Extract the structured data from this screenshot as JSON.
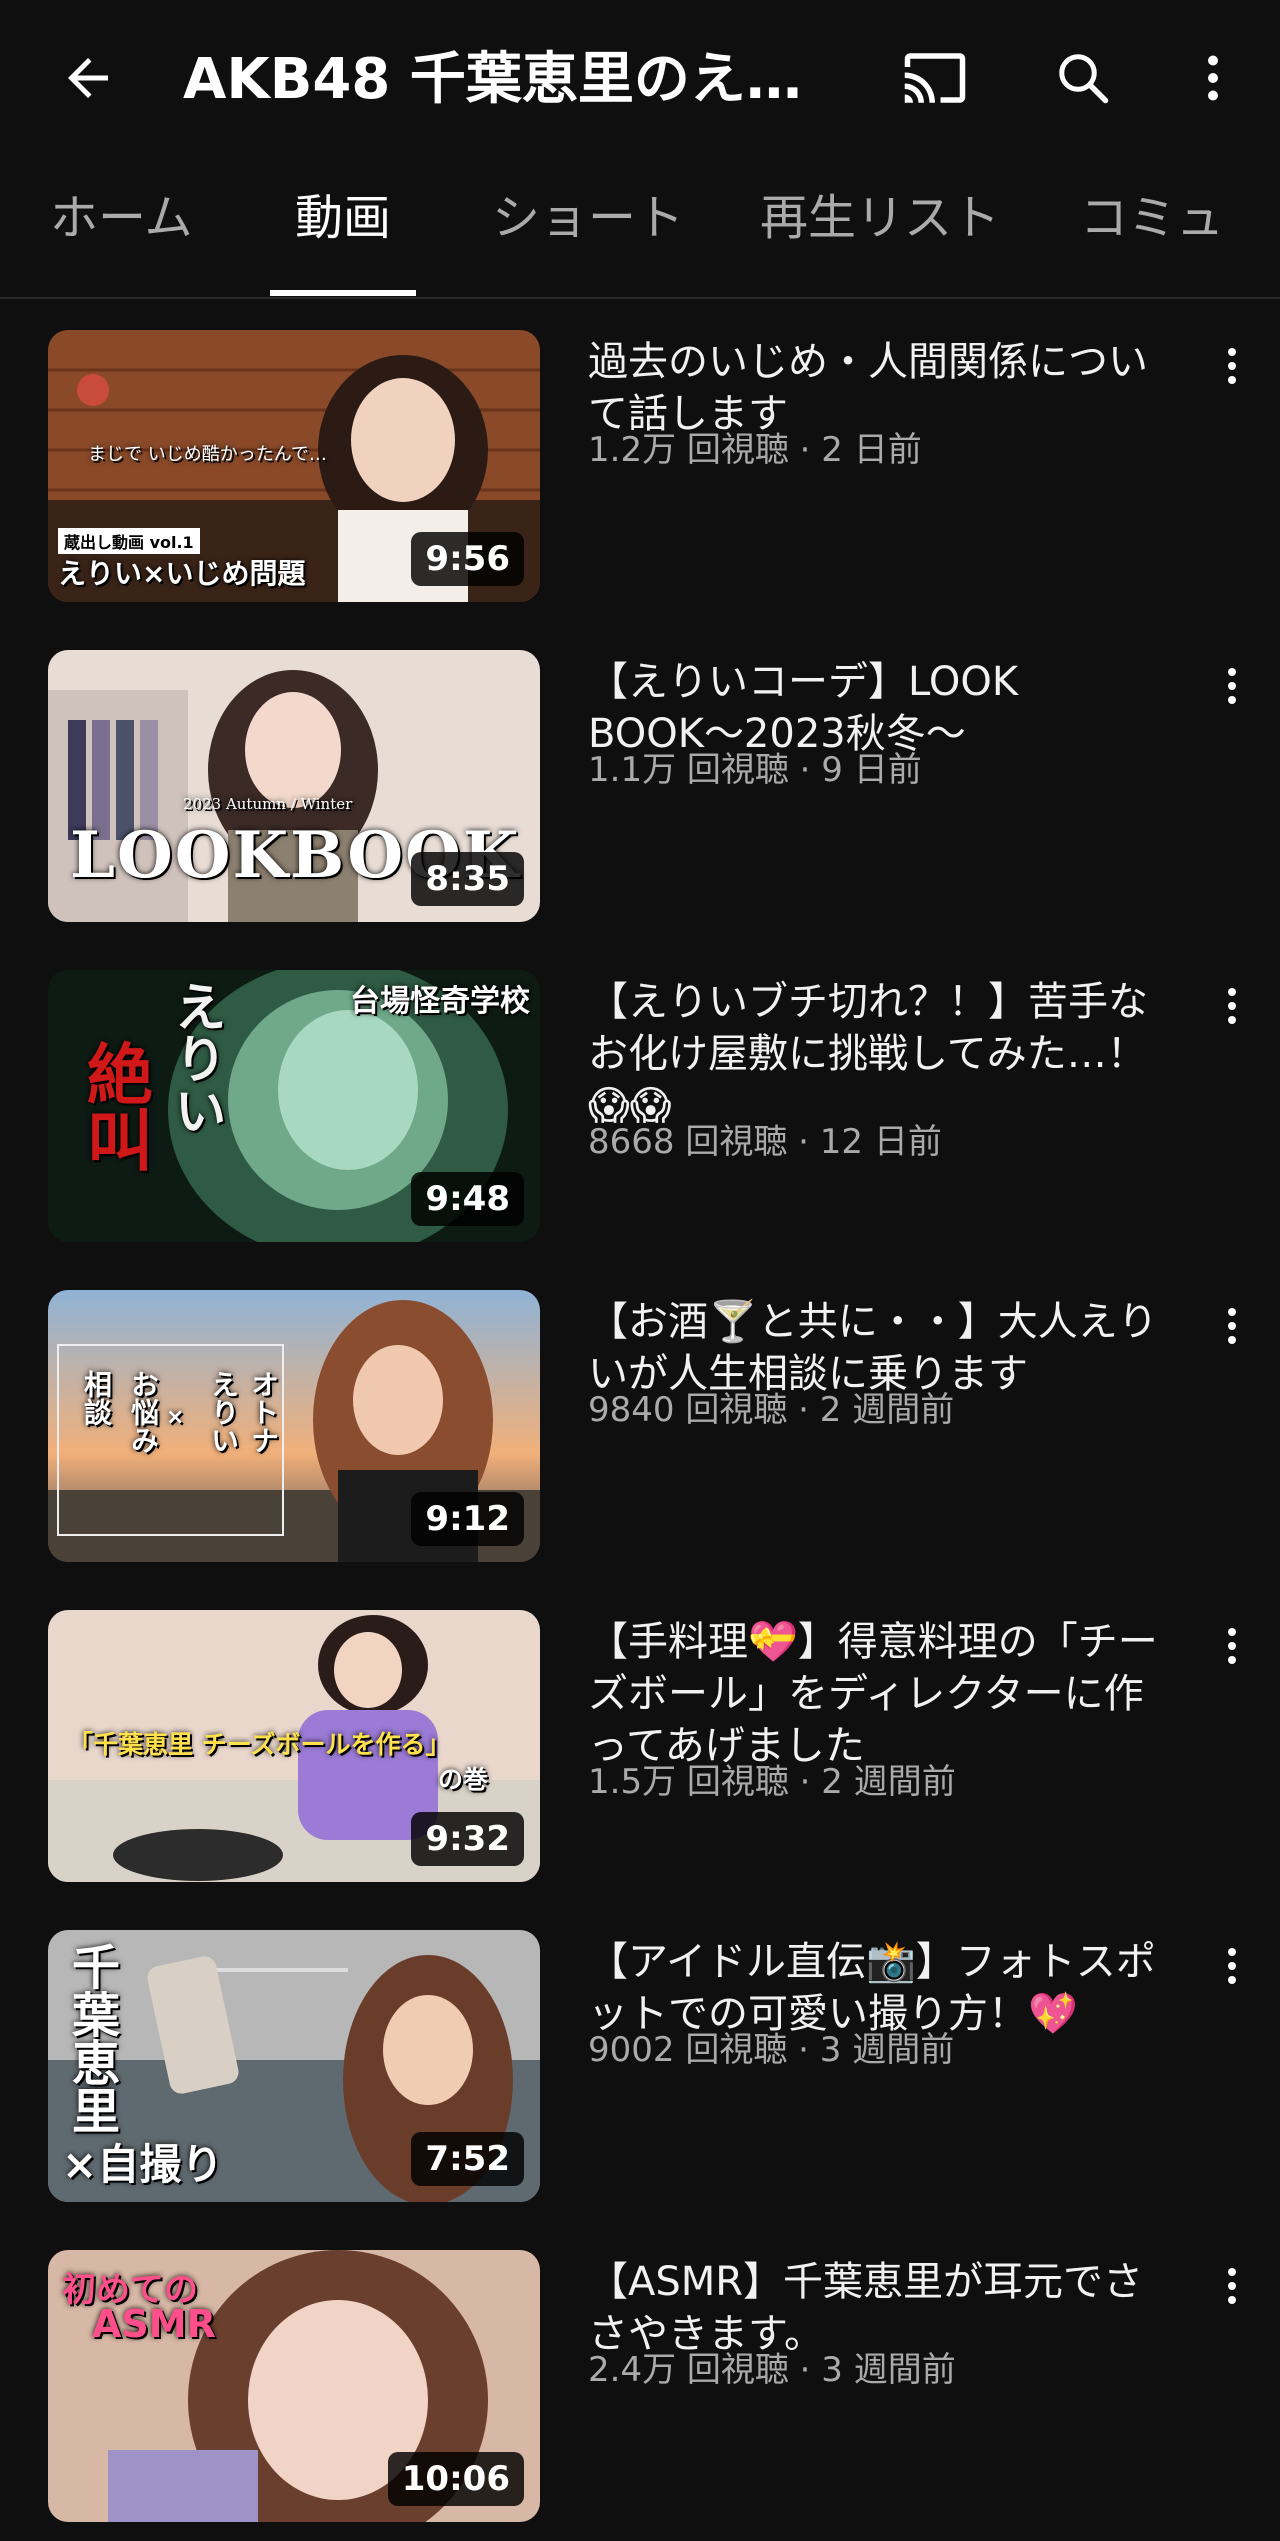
{
  "header": {
    "title": "AKB48 千葉恵里のえ…",
    "icons": [
      "back-arrow-icon",
      "cast-icon",
      "search-icon",
      "more-vert-icon"
    ]
  },
  "tabs": [
    {
      "label": "ホーム",
      "active": false
    },
    {
      "label": "動画",
      "active": true
    },
    {
      "label": "ショート",
      "active": false
    },
    {
      "label": "再生リスト",
      "active": false
    },
    {
      "label": "コミュ",
      "active": false
    }
  ],
  "videos": [
    {
      "title": "過去のいじめ・人間関係について話します",
      "meta": "1.2万 回視聴 · 2 日前",
      "duration": "9:56",
      "thumb_text": [
        "えりい×いじめ問題",
        "蔵出し動画 vol.1",
        "まじで いじめ酷かったんで…"
      ]
    },
    {
      "title": "【えりいコーデ】LOOK BOOK〜2023秋冬〜",
      "meta": "1.1万 回視聴 · 9 日前",
      "duration": "8:35",
      "thumb_text": [
        "LOOKBOOK",
        "2023 Autumn / Winter"
      ]
    },
    {
      "title": "【えりいブチ切れ？！】苦手なお化け屋敷に挑戦してみた…！😱😱",
      "meta": "8668 回視聴 · 12 日前",
      "duration": "9:48",
      "thumb_text": [
        "台場怪奇学校",
        "えりい",
        "絶叫"
      ]
    },
    {
      "title": "【お酒🍸と共に・・】大人えりいが人生相談に乗ります",
      "meta": "9840 回視聴 · 2 週間前",
      "duration": "9:12",
      "thumb_text": [
        "オトナ",
        "えりい",
        "×",
        "お悩み",
        "相談"
      ]
    },
    {
      "title": "【手料理💝】得意料理の「チーズボール」をディレクターに作ってあげました",
      "meta": "1.5万 回視聴 · 2 週間前",
      "duration": "9:32",
      "thumb_text": [
        "「千葉恵里 チーズボールを作る」",
        "の巻"
      ]
    },
    {
      "title": "【アイドル直伝📸】フォトスポットでの可愛い撮り方！💖",
      "meta": "9002 回視聴 · 3 週間前",
      "duration": "7:52",
      "thumb_text": [
        "千葉恵里",
        "×自撮り"
      ]
    },
    {
      "title": "【ASMR】千葉恵里が耳元でささやきます。",
      "meta": "2.4万 回視聴 · 3 週間前",
      "duration": "10:06",
      "thumb_text": [
        "初めての",
        "ASMR"
      ]
    }
  ],
  "colors": {
    "background": "#0f0f0f",
    "text": "#f1f1f1",
    "muted": "#aaaaaa"
  }
}
